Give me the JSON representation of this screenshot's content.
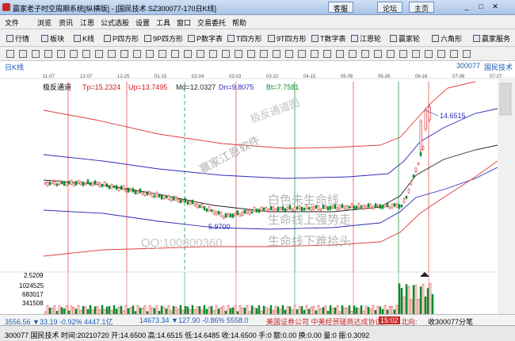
{
  "window": {
    "title": "赢家老子时空周期系统[纵横版] - [国民技术  SZ300077-170日K线]",
    "buttons": [
      "客服",
      "论坛",
      "主页"
    ]
  },
  "menu": [
    "文件",
    "浏览",
    "资讯",
    "江恩",
    "公式选股",
    "设置",
    "工具",
    "窗口",
    "交易委托",
    "帮助"
  ],
  "toolbar": [
    "行情",
    "板块",
    "K线",
    "P四方形",
    "9P四方形",
    "P数字表",
    "T四方形",
    "9T四方形",
    "T数字表",
    "江恩轮",
    "赢家轮",
    "六角形",
    "赢家服务"
  ],
  "tabs": {
    "left": "日K线",
    "right_code": "300077",
    "right_name": "国民技术"
  },
  "chart": {
    "indicator_name": "极反通道",
    "values": [
      "Tp=15.2324",
      "Up=13.7495",
      "Md=12.0327",
      "Dn=9.8075",
      "Bt=7.7581"
    ],
    "dates": [
      "11-07",
      "12-07",
      "12-25",
      "01-15",
      "02-04",
      "03-03",
      "03-22",
      "04-15",
      "05-06",
      "05-26",
      "06-16",
      "07-06",
      "07-27"
    ],
    "high_label": "14.6515",
    "low_label": "5.9700",
    "volume_ticks": [
      "2.5209",
      "1024525",
      "683017",
      "341508"
    ],
    "watermark": {
      "w1": "赢家江恩软件",
      "w2": "极反通道图",
      "w3": "QQ:100800360",
      "w4": "白色未生命线",
      "w5": "生命线上强势走",
      "w6": "生命线下难拾头"
    }
  },
  "status": {
    "idx1": "3556.56 ▼33.19 -0.92% 4447.1亿",
    "idx2": "14673.34 ▼127.90 -0.86% 5558.0",
    "news": "美国证券公司 中美经贸磋商达成协议。",
    "time": "15:02",
    "north": "北向:",
    "alert": "收300077分笔",
    "bottom": "300077 国民技术 时间:20210720 开:14.6500 高:14.6515 低:14.6485 收:14.6500 手:0 额:0.00 换:0.00 量:0 振:0.3092"
  },
  "colors": {
    "candle_up": "#d01818",
    "candle_down": "#0a8a2a",
    "band_outer": "#e03b3b",
    "band_mid": "#2b2bb8",
    "band_inner": "#222222"
  }
}
